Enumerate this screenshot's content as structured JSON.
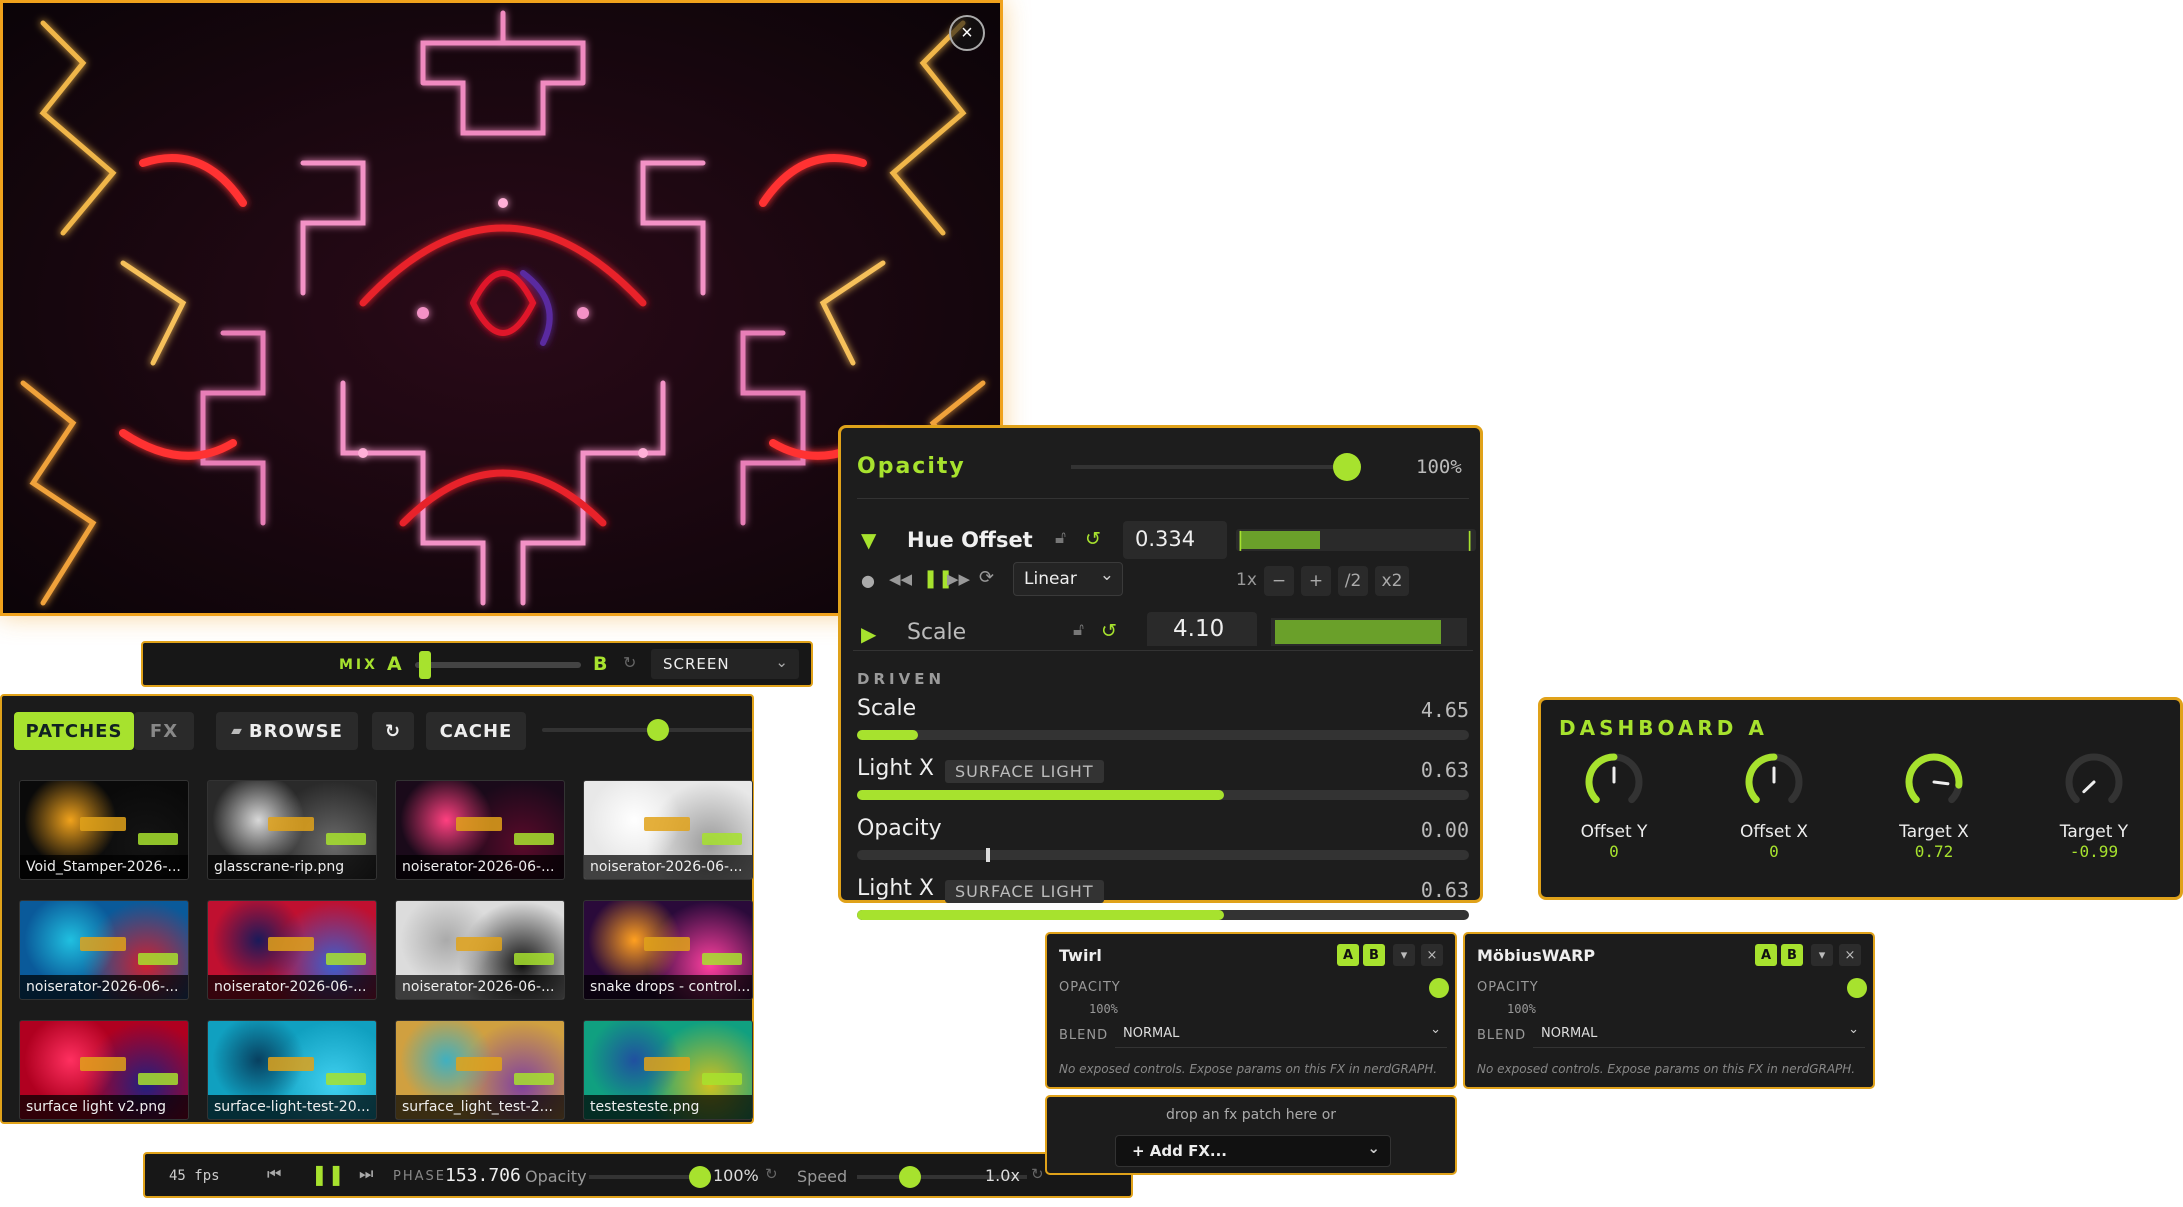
{
  "preview": {
    "close_glyph": "×"
  },
  "mix": {
    "label": "MIX",
    "a": "A",
    "b": "B",
    "position": 0.06,
    "blend": "SCREEN"
  },
  "library": {
    "tabs": {
      "patches": "PATCHES",
      "fx": "FX"
    },
    "browse": "BROWSE",
    "cache": "CACHE",
    "thumb_size": 0.55,
    "items": [
      {
        "name": "Void_Stamper-2026-..."
      },
      {
        "name": "glasscrane-rip.png"
      },
      {
        "name": "noiserator-2026-06-..."
      },
      {
        "name": "noiserator-2026-06-..."
      },
      {
        "name": "noiserator-2026-06-..."
      },
      {
        "name": "noiserator-2026-06-..."
      },
      {
        "name": "noiserator-2026-06-..."
      },
      {
        "name": "snake drops - control..."
      },
      {
        "name": "surface light v2.png"
      },
      {
        "name": "surface-light-test-20..."
      },
      {
        "name": "surface_light_test-2..."
      },
      {
        "name": "testesteste.png"
      }
    ]
  },
  "transport": {
    "fps": "45 fps",
    "phase_label": "PHASE",
    "phase_value": "153.706",
    "opacity_label": "Opacity",
    "opacity_value": "100%",
    "speed_label": "Speed",
    "speed_value": "1.0x"
  },
  "params": {
    "opacity": {
      "label": "Opacity",
      "value": "100%",
      "level": 1.0
    },
    "hue": {
      "label": "Hue Offset",
      "value": "0.334",
      "mode": "Linear",
      "rate": "1x",
      "buttons": {
        "minus": "−",
        "plus": "+",
        "half": "/2",
        "double": "x2"
      }
    },
    "scale": {
      "label": "Scale",
      "value": "4.10"
    },
    "driven_label": "DRIVEN",
    "driven": [
      {
        "label": "Scale",
        "tag": "",
        "value": "4.65",
        "level": 0.1
      },
      {
        "label": "Light X",
        "tag": "SURFACE LIGHT",
        "value": "0.63",
        "level": 0.6
      },
      {
        "label": "Opacity",
        "tag": "",
        "value": "0.00",
        "level": 0.21
      },
      {
        "label": "Light X",
        "tag": "SURFACE LIGHT",
        "value": "0.63",
        "level": 0.6
      }
    ]
  },
  "dashboard": {
    "title": "DASHBOARD A",
    "knobs": [
      {
        "name": "Offset Y",
        "value": "0",
        "level": 0.5
      },
      {
        "name": "Offset X",
        "value": "0",
        "level": 0.5
      },
      {
        "name": "Target X",
        "value": "0.72",
        "level": 0.86
      },
      {
        "name": "Target Y",
        "value": "-0.99",
        "level": 0.005
      }
    ]
  },
  "fx": [
    {
      "title": "Twirl",
      "opacity_label": "OPACITY",
      "opacity_value": "100%",
      "blend_label": "BLEND",
      "blend_value": "NORMAL",
      "note": "No exposed controls. Expose params on this FX in nerdGRAPH.",
      "a": "A",
      "b": "B"
    },
    {
      "title": "MöbiusWARP",
      "opacity_label": "OPACITY",
      "opacity_value": "100%",
      "blend_label": "BLEND",
      "blend_value": "NORMAL",
      "note": "No exposed controls. Expose params on this FX in nerdGRAPH.",
      "a": "A",
      "b": "B"
    }
  ],
  "drop": {
    "hint": "drop an fx patch here or",
    "add": "+ Add FX..."
  },
  "colors": {
    "accent": "#a7e22e",
    "border": "#e0a21a",
    "panel": "#1c1c1c"
  }
}
